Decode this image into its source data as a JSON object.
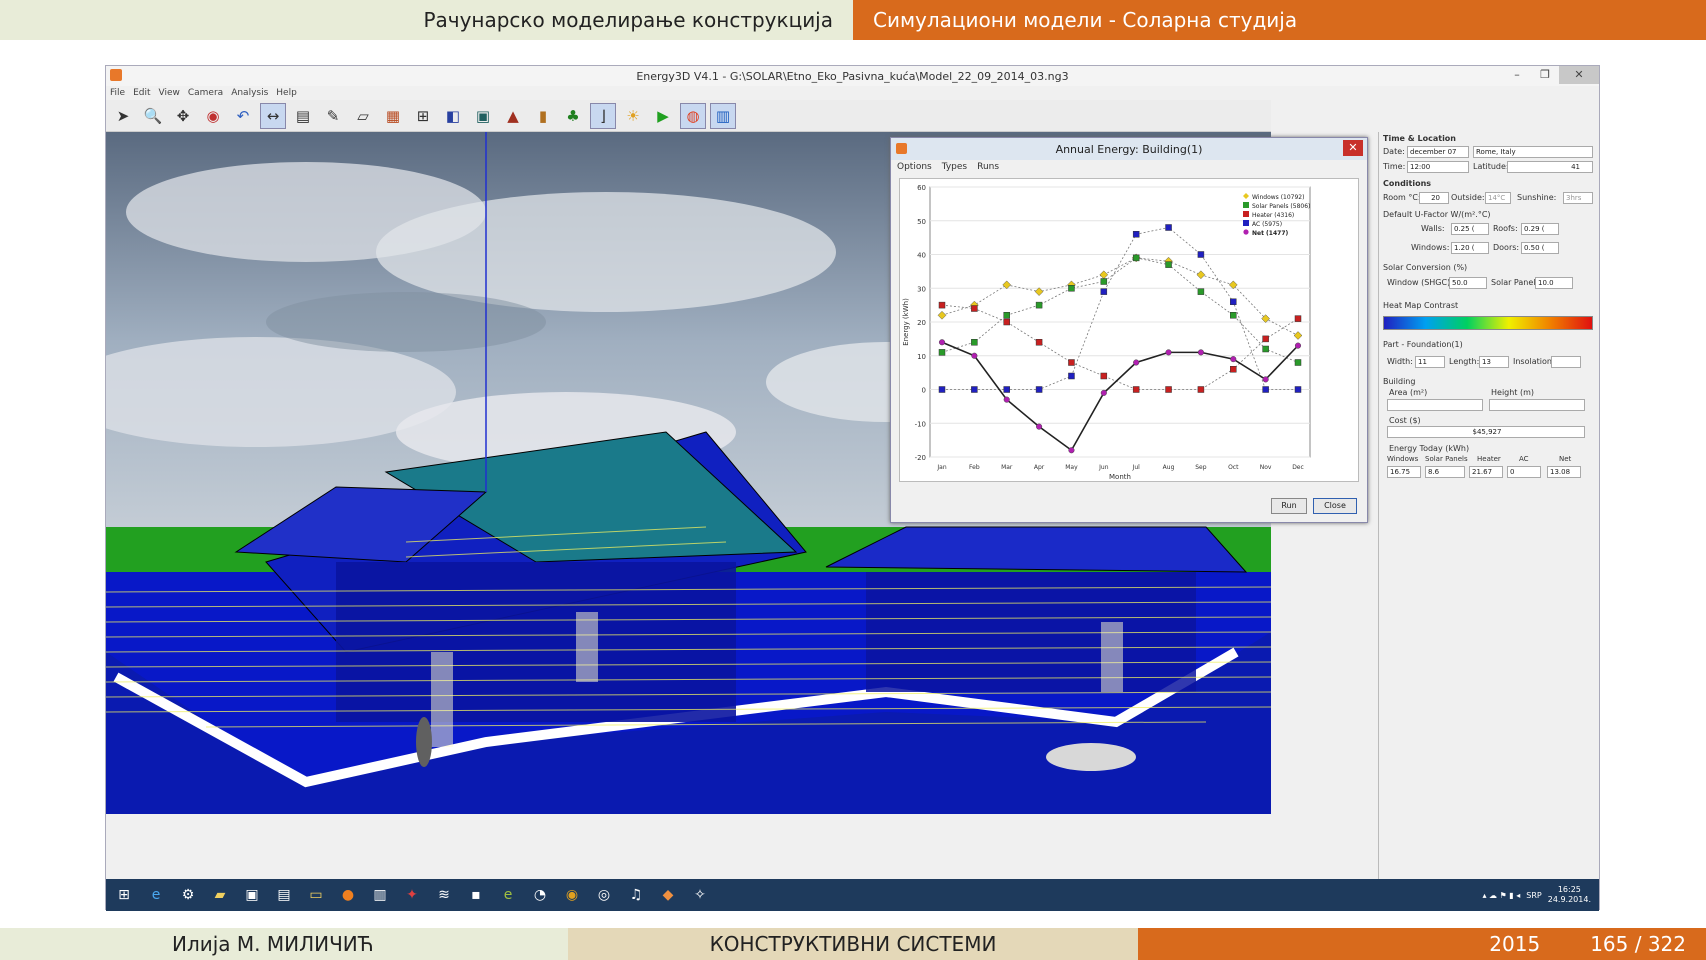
{
  "slide": {
    "header_left": "Рачунарско моделирање конструкција",
    "header_right": "Симулациони модели - Соларна студија",
    "footer_author": "Илија М. МИЛИЧИЋ",
    "footer_course": "КОНСТРУКТИВНИ СИСТЕМИ",
    "footer_year": "2015",
    "footer_page": "165 / 322"
  },
  "window": {
    "title": "Energy3D V4.1 - G:\\SOLAR\\Etno_Eko_Pasivna_kuća\\Model_22_09_2014_03.ng3",
    "minimize": "–",
    "restore": "❐",
    "close": "✕",
    "menu": [
      "File",
      "Edit",
      "View",
      "Camera",
      "Analysis",
      "Help"
    ]
  },
  "toolbar": {
    "icons": [
      "select-icon",
      "zoom-icon",
      "move-icon",
      "rotate-icon",
      "undo-icon",
      "measure-icon",
      "grid-icon",
      "note-icon",
      "foundation-icon",
      "wall-icon",
      "window-icon",
      "solar-panel-icon",
      "roof-icon",
      "door-icon",
      "tree-icon",
      "shadow-icon",
      "sun-icon",
      "run-icon",
      "heatmap-icon",
      "energy-icon"
    ]
  },
  "dialog": {
    "title": "Annual Energy: Building(1)",
    "close": "✕",
    "menu": [
      "Options",
      "Types",
      "Runs"
    ],
    "run_label": "Run",
    "close_label": "Close"
  },
  "chart_data": {
    "type": "line",
    "categories": [
      "Jan",
      "Feb",
      "Mar",
      "Apr",
      "May",
      "Jun",
      "Jul",
      "Aug",
      "Sep",
      "Oct",
      "Nov",
      "Dec"
    ],
    "ylabel": "Energy (kWh)",
    "xlabel": "Month",
    "ylim": [
      -20,
      60
    ],
    "yticks": [
      -20,
      -10,
      0,
      10,
      20,
      30,
      40,
      50,
      60
    ],
    "legend_position": "top-right",
    "series": [
      {
        "name": "Windows (10792)",
        "color": "#e8c820",
        "marker": "diamond",
        "values": [
          22,
          25,
          31,
          29,
          31,
          34,
          39,
          38,
          34,
          31,
          21,
          16
        ]
      },
      {
        "name": "Solar Panels (5806)",
        "color": "#2a9a2a",
        "marker": "square",
        "values": [
          11,
          14,
          22,
          25,
          30,
          32,
          39,
          37,
          29,
          22,
          12,
          8
        ]
      },
      {
        "name": "Heater (4316)",
        "color": "#c82020",
        "marker": "square",
        "values": [
          25,
          24,
          20,
          14,
          8,
          4,
          0,
          0,
          0,
          6,
          15,
          21
        ]
      },
      {
        "name": "AC (5975)",
        "color": "#2020c0",
        "marker": "square",
        "values": [
          0,
          0,
          0,
          0,
          4,
          29,
          46,
          48,
          40,
          26,
          0,
          0
        ]
      },
      {
        "name": "Net (1477)",
        "color": "#222222",
        "marker": "circle",
        "values": [
          14,
          10,
          -3,
          -11,
          -18,
          -1,
          8,
          11,
          11,
          9,
          3,
          13
        ]
      }
    ]
  },
  "side": {
    "time_location": "Time & Location",
    "date_label": "Date:",
    "date": "december 07",
    "location": "Rome, Italy",
    "time_label": "Time:",
    "time": "12:00",
    "latitude_label": "Latitude:",
    "latitude": "41",
    "conditions": "Conditions",
    "room_label": "Room °C:",
    "room": "20",
    "outside_label": "Outside:",
    "outside": "14°C",
    "sunshine_label": "Sunshine:",
    "sunshine": "3hrs",
    "ufactor": "Default U-Factor W/(m².°C)",
    "walls_label": "Walls:",
    "walls": "0.25 (",
    "roofs_label": "Roofs:",
    "roofs": "0.29 (",
    "windows_label": "Windows:",
    "windows": "1.20 (",
    "doors_label": "Doors:",
    "doors": "0.50 (",
    "solar_conv": "Solar Conversion (%)",
    "shgc_label": "Window (SHGC):",
    "shgc": "50.0",
    "panel_label": "Solar Panel:",
    "panel": "10.0",
    "heatmap": "Heat Map Contrast",
    "part": "Part - Foundation(1)",
    "width_label": "Width:",
    "width": "11",
    "length_label": "Length:",
    "length": "13",
    "insolation_label": "Insolation:",
    "building": "Building",
    "area_label": "Area (m²)",
    "height_label": "Height (m)",
    "cost_label": "Cost ($)",
    "cost": "$45,927",
    "energy_today": "Energy Today (kWh)",
    "et_headers": [
      "Windows",
      "Solar Panels",
      "Heater",
      "AC",
      "Net"
    ],
    "et_values": [
      "16.75",
      "8.6",
      "21.67",
      "0",
      "13.08"
    ]
  },
  "taskbar": {
    "icons": [
      "start-icon",
      "ie-icon",
      "network-icon",
      "folder-icon",
      "save-icon",
      "doc-icon",
      "explorer-icon",
      "media-icon",
      "notepad-icon",
      "tool-icon",
      "app-icon",
      "cmd-icon",
      "eclipse-icon",
      "search-app-icon",
      "chrome-icon",
      "globe-icon",
      "music-icon",
      "energy3d-icon",
      "settings-icon"
    ],
    "lang": "SRP",
    "time": "16:25",
    "date": "24.9.2014."
  }
}
